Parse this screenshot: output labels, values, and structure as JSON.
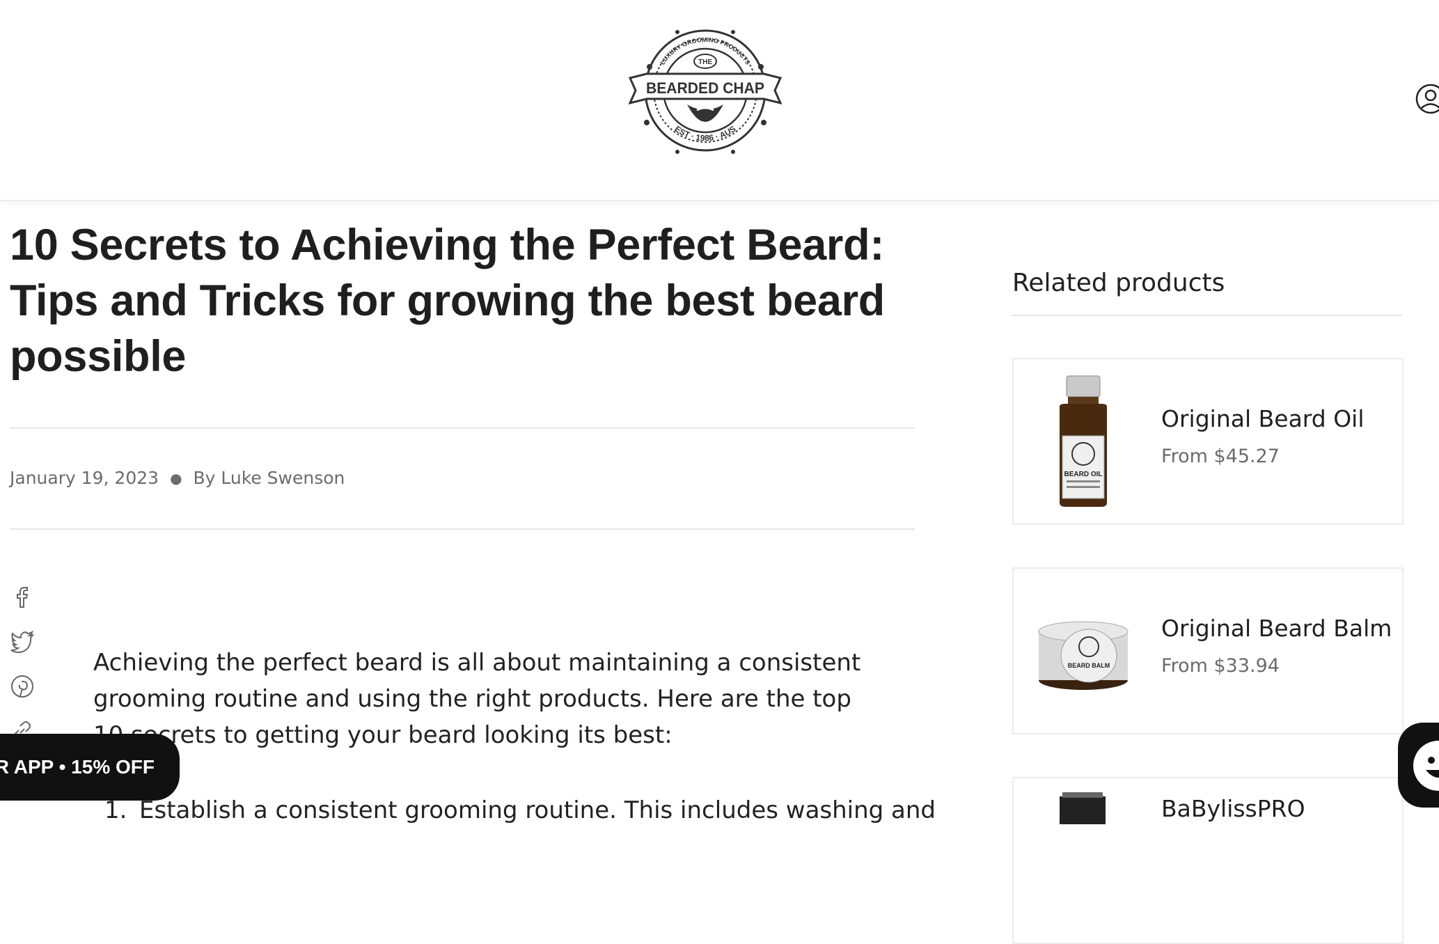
{
  "header": {
    "logo": {
      "top_text": "LUXURY GROOMING PRODUCTS",
      "the": "THE",
      "brand": "BEARDED CHAP",
      "est": "EST · 1986 · AUS"
    },
    "account_icon": "account-icon"
  },
  "article": {
    "title": "10 Secrets to Achieving the Perfect Beard: Tips and Tricks for growing the best beard possible",
    "date": "January 19, 2023",
    "author": "By Luke Swenson",
    "share_icons": [
      "facebook-icon",
      "twitter-icon",
      "pinterest-icon",
      "link-icon"
    ],
    "intro": "Achieving the perfect beard is all about maintaining a consistent grooming routine and using the right products. Here are the top 10 secrets to getting your beard looking its best:",
    "list": [
      {
        "num": "1.",
        "text": "Establish a consistent grooming routine. This includes washing and"
      }
    ]
  },
  "sidebar": {
    "heading": "Related products",
    "products": [
      {
        "name": "Original Beard Oil",
        "price": "From $45.27",
        "label": "BEARD OIL"
      },
      {
        "name": "Original Beard Balm",
        "price": "From $33.94",
        "label": "BEARD BALM"
      },
      {
        "name": "BaBylissPRO",
        "price": ""
      }
    ]
  },
  "app_banner": {
    "text": "R APP • 15% OFF"
  },
  "colors": {
    "text": "#1f1f1f",
    "muted": "#6b6b6b",
    "border": "#ececec",
    "banner": "#111111"
  }
}
